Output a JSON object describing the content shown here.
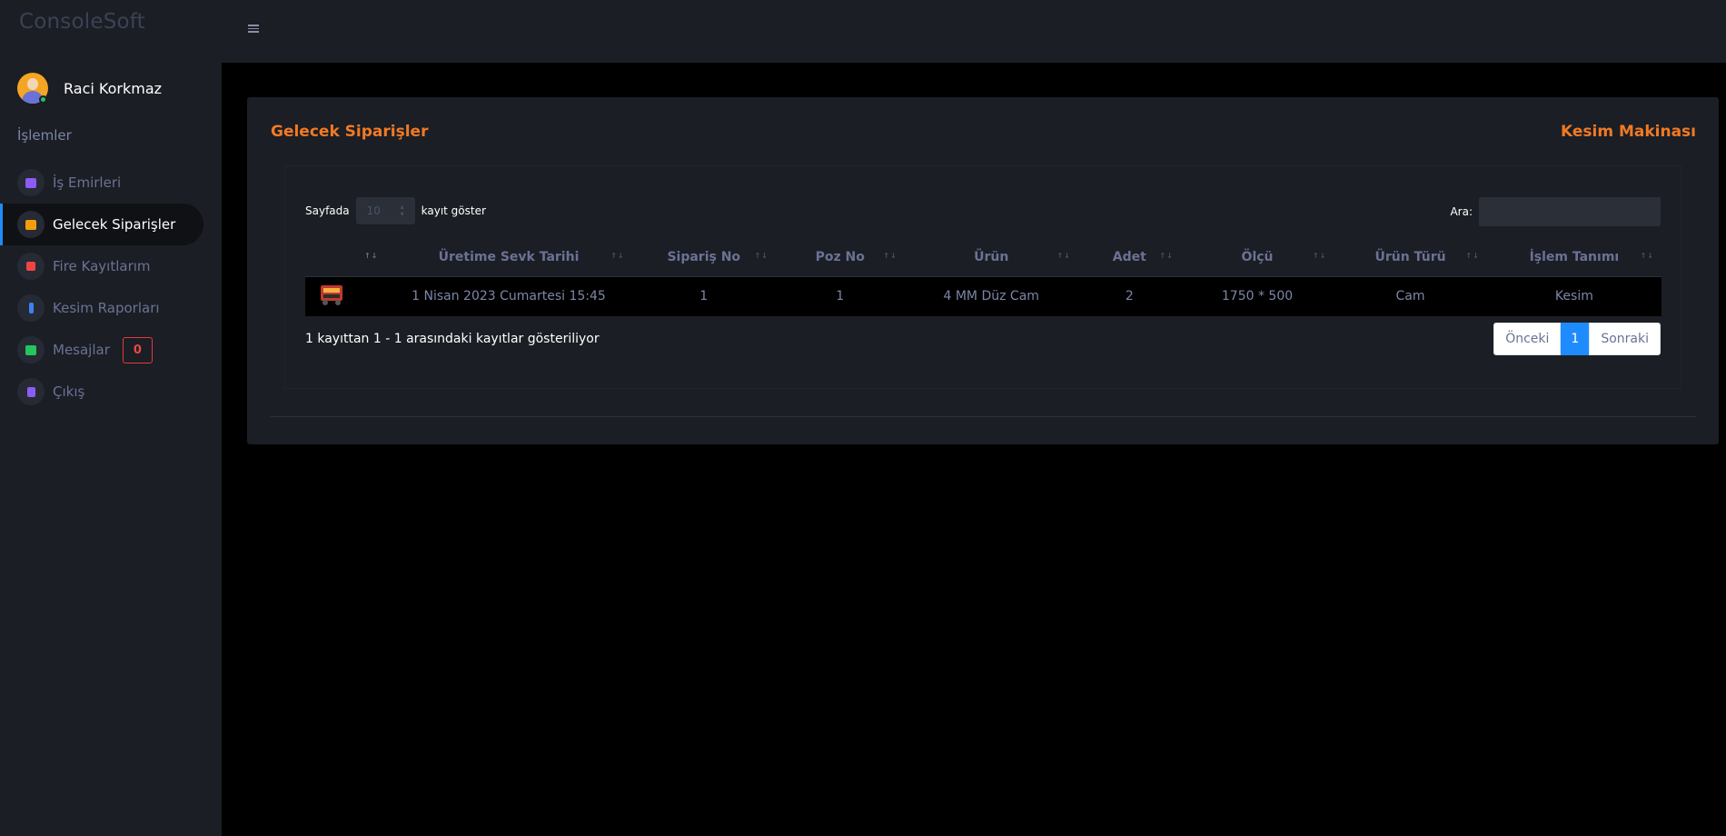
{
  "brand": "ConsoleSoft",
  "user": {
    "name": "Raci Korkmaz"
  },
  "sidebar": {
    "section_label": "İşlemler",
    "items": [
      {
        "label": "İş Emirleri",
        "icon": "book-icon",
        "color": "#8b5cf6"
      },
      {
        "label": "Gelecek Siparişler",
        "icon": "list-icon",
        "color": "#f59e0b",
        "active": true
      },
      {
        "label": "Fire Kayıtlarım",
        "icon": "chart-icon",
        "color": "#ef4444"
      },
      {
        "label": "Kesim Raporları",
        "icon": "phone-icon",
        "color": "#3b82f6"
      },
      {
        "label": "Mesajlar",
        "icon": "chat-icon",
        "color": "#22c55e",
        "badge": "0"
      },
      {
        "label": "Çıkış",
        "icon": "logout-icon",
        "color": "#8b5cf6"
      }
    ]
  },
  "card": {
    "title": "Gelecek Siparişler",
    "right_title": "Kesim Makinası",
    "length": {
      "prefix": "Sayfada",
      "value": "10",
      "suffix": "kayıt göster"
    },
    "search": {
      "label": "Ara:",
      "value": ""
    },
    "table": {
      "headers": [
        "",
        "Üretime Sevk Tarihi",
        "Sipariş No",
        "Poz No",
        "Ürün",
        "Adet",
        "Ölçü",
        "Ürün Türü",
        "İşlem Tanımı"
      ],
      "rows": [
        [
          "",
          "1 Nisan 2023 Cumartesi 15:45",
          "1",
          "1",
          "4 MM Düz Cam",
          "2",
          "1750 * 500",
          "Cam",
          "Kesim"
        ]
      ]
    },
    "info": "1 kayıttan 1 - 1 arasındaki kayıtlar gösteriliyor",
    "pagination": {
      "prev": "Önceki",
      "current": "1",
      "next": "Sonraki"
    }
  },
  "colors": {
    "accent": "#f07a25",
    "primary": "#1e8cff",
    "danger": "#e03b3b"
  }
}
